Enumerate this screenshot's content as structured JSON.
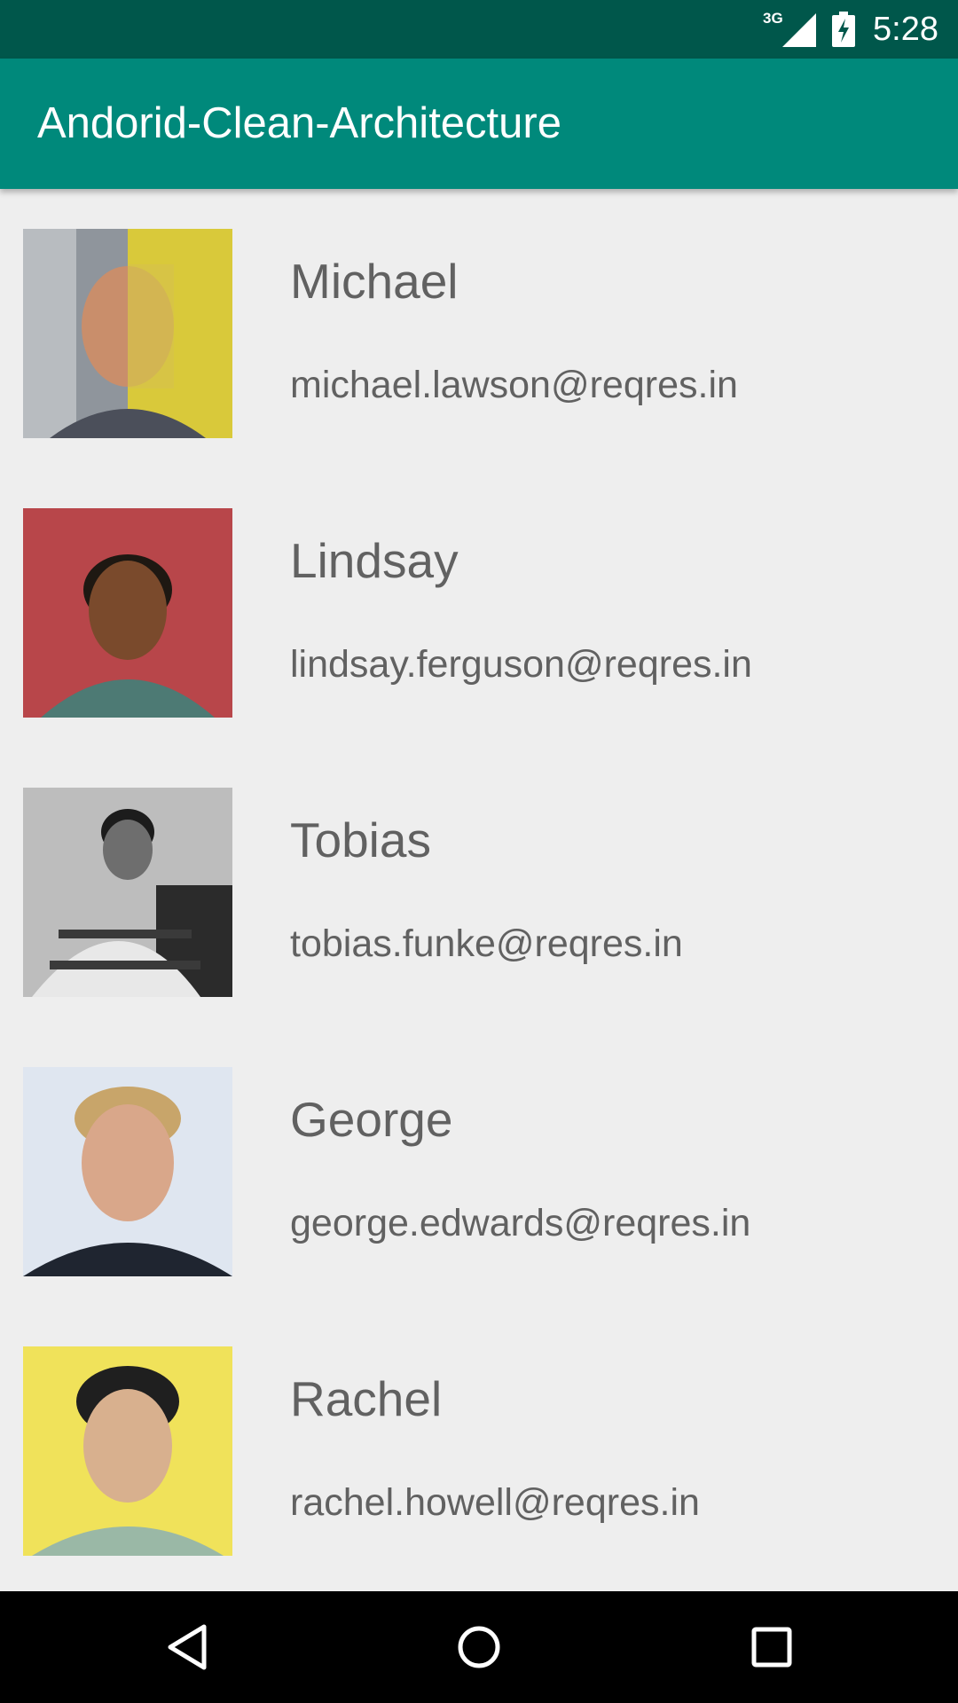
{
  "status_bar": {
    "network_label": "3G",
    "time": "5:28",
    "icons": [
      "signal-icon",
      "battery-charging-icon"
    ]
  },
  "app_bar": {
    "title": "Andorid-Clean-Architecture"
  },
  "users": [
    {
      "name": "Michael",
      "email": "michael.lawson@reqres.in",
      "avatar_colors": [
        "#f2e33a",
        "#8a8f96"
      ]
    },
    {
      "name": "Lindsay",
      "email": "lindsay.ferguson@reqres.in",
      "avatar_colors": [
        "#b8464a",
        "#3b2a22"
      ]
    },
    {
      "name": "Tobias",
      "email": "tobias.funke@reqres.in",
      "avatar_colors": [
        "#bdbdbd",
        "#2e2e2e"
      ]
    },
    {
      "name": "George",
      "email": "george.edwards@reqres.in",
      "avatar_colors": [
        "#dfe6f0",
        "#c8a56a"
      ]
    },
    {
      "name": "Rachel",
      "email": "rachel.howell@reqres.in",
      "avatar_colors": [
        "#f0e25a",
        "#1f1f1f"
      ]
    }
  ],
  "nav_bar": {
    "buttons": [
      "back-icon",
      "home-icon",
      "recents-icon"
    ]
  }
}
